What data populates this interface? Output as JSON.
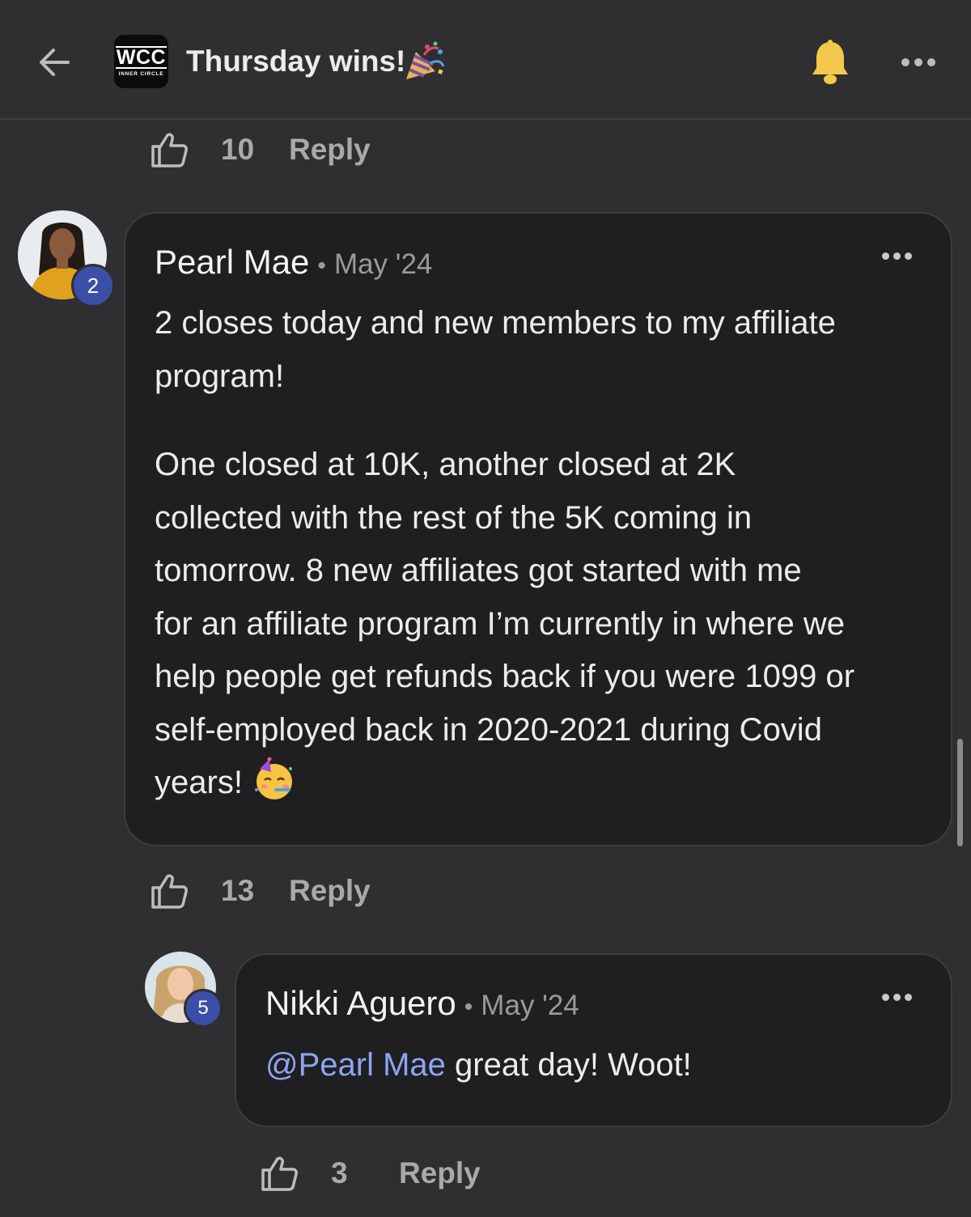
{
  "header": {
    "title": "Thursday wins!",
    "title_emoji": "party-popper-icon",
    "logo_main": "WCC",
    "logo_sub": "INNER CIRCLE"
  },
  "top_actions": {
    "likes": "10",
    "reply_label": "Reply"
  },
  "comments": [
    {
      "author": "Pearl Mae",
      "date": "May '24",
      "level": "2",
      "paragraph1": "2 closes today and new members to my affiliate\nprogram!",
      "paragraph2": "One closed at 10K, another closed at 2K\ncollected with the rest of the 5K coming in\ntomorrow. 8 new affiliates got started with me\nfor an affiliate program I’m currently in where we\nhelp people get refunds back if you were 1099 or\nself-employed back in 2020-2021 during Covid\nyears! ",
      "trailing_emoji": "partying-face-icon",
      "likes": "13",
      "reply_label": "Reply"
    },
    {
      "author": "Nikki Aguero",
      "date": "May '24",
      "level": "5",
      "mention": "@Pearl Mae",
      "text": " great day! Woot!",
      "likes": "3",
      "reply_label": "Reply"
    }
  ],
  "colors": {
    "background": "#2f2f31",
    "card": "#1f1f21",
    "mention": "#8fa4f2",
    "badge": "#3b4fa8",
    "bell": "#f2c94c"
  }
}
